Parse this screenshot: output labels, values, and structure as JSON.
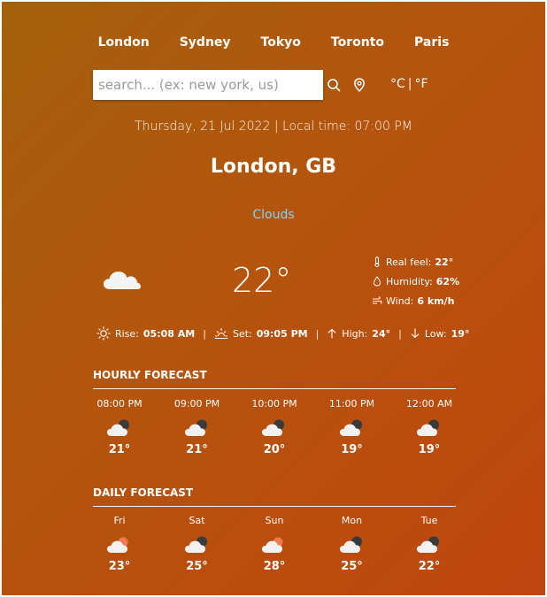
{
  "cities": [
    "London",
    "Sydney",
    "Tokyo",
    "Toronto",
    "Paris"
  ],
  "search": {
    "placeholder": "search... (ex: new york, us)",
    "value": ""
  },
  "icons": {
    "search": "search-icon",
    "location": "location-pin-icon"
  },
  "units": {
    "celsius": "°C",
    "separator": "|",
    "fahrenheit": "°F"
  },
  "date_line": "Thursday, 21 Jul 2022 | Local time: 07:00 PM",
  "location": "London, GB",
  "condition": "Clouds",
  "temperature": "22°",
  "details": {
    "real_feel_label": "Real feel:",
    "real_feel_value": "22°",
    "humidity_label": "Humidity:",
    "humidity_value": "62%",
    "wind_label": "Wind:",
    "wind_value": "6 km/h"
  },
  "sunbar": {
    "rise_label": "Rise:",
    "rise_value": "05:08 AM",
    "set_label": "Set:",
    "set_value": "09:05 PM",
    "high_label": "High:",
    "high_value": "24°",
    "low_label": "Low:",
    "low_value": "19°"
  },
  "hourly": {
    "title": "HOURLY FORECAST",
    "items": [
      {
        "time": "08:00 PM",
        "icon": "night-cloud-icon",
        "temp": "21°"
      },
      {
        "time": "09:00 PM",
        "icon": "night-cloud-icon",
        "temp": "21°"
      },
      {
        "time": "10:00 PM",
        "icon": "night-cloud-icon",
        "temp": "20°"
      },
      {
        "time": "11:00 PM",
        "icon": "night-cloud-icon",
        "temp": "19°"
      },
      {
        "time": "12:00 AM",
        "icon": "night-cloud-icon",
        "temp": "19°"
      }
    ]
  },
  "daily": {
    "title": "DAILY FORECAST",
    "items": [
      {
        "day": "Fri",
        "icon": "sun-cloud-icon",
        "temp": "23°"
      },
      {
        "day": "Sat",
        "icon": "night-cloud-icon",
        "temp": "25°"
      },
      {
        "day": "Sun",
        "icon": "sun-cloud-icon",
        "temp": "28°"
      },
      {
        "day": "Mon",
        "icon": "night-cloud-icon",
        "temp": "25°"
      },
      {
        "day": "Tue",
        "icon": "night-cloud-icon",
        "temp": "22°"
      }
    ]
  },
  "colors": {
    "bg_start": "#a4610b",
    "bg_end": "#c0460f",
    "condition": "#7fd4f2"
  }
}
